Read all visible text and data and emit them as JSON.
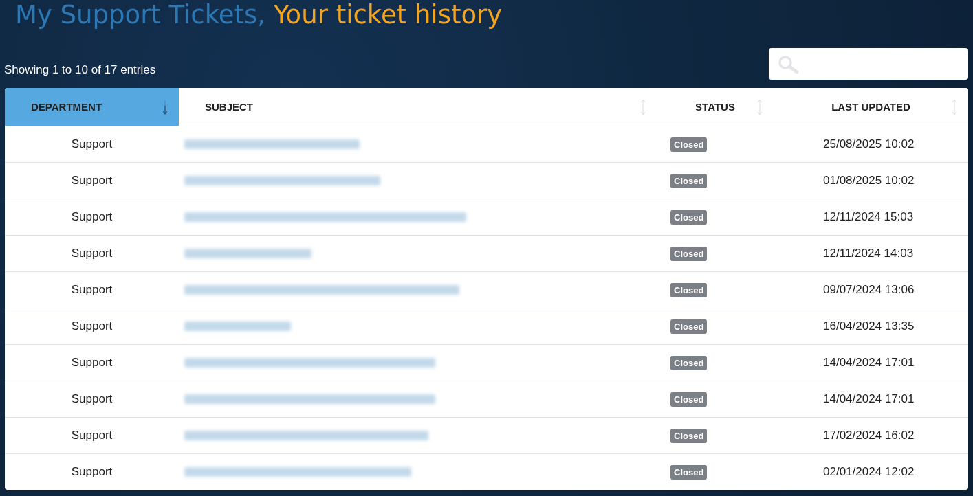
{
  "title": {
    "primary": "My Support Tickets,",
    "secondary": "Your ticket history"
  },
  "info": "Showing 1 to 10 of 17 entries",
  "table": {
    "columns": [
      {
        "label": "DEPARTMENT",
        "sorted": true
      },
      {
        "label": "SUBJECT",
        "sorted": false
      },
      {
        "label": "STATUS",
        "sorted": false
      },
      {
        "label": "LAST UPDATED",
        "sorted": false
      }
    ],
    "rows": [
      {
        "department": "Support",
        "subject": {
          "kind": "redacted"
        },
        "status": "Closed",
        "updated": "25/08/2025 10:02"
      },
      {
        "department": "Support",
        "subject": {
          "kind": "redacted"
        },
        "status": "Closed",
        "updated": "01/08/2025 10:02"
      },
      {
        "department": "Support",
        "subject": {
          "kind": "redacted"
        },
        "status": "Closed",
        "updated": "12/11/2024 15:03"
      },
      {
        "department": "Support",
        "subject": {
          "kind": "redacted"
        },
        "status": "Closed",
        "updated": "12/11/2024 14:03"
      },
      {
        "department": "Support",
        "subject": {
          "kind": "redacted"
        },
        "status": "Closed",
        "updated": "09/07/2024 13:06"
      },
      {
        "department": "Support",
        "subject": {
          "kind": "redacted"
        },
        "status": "Closed",
        "updated": "16/04/2024 13:35"
      },
      {
        "department": "Support",
        "subject": {
          "kind": "redacted"
        },
        "status": "Closed",
        "updated": "14/04/2024 17:01"
      },
      {
        "department": "Support",
        "subject": {
          "kind": "redacted"
        },
        "status": "Closed",
        "updated": "14/04/2024 17:01"
      },
      {
        "department": "Support",
        "subject": {
          "kind": "redacted"
        },
        "status": "Closed",
        "updated": "17/02/2024 16:02"
      },
      {
        "department": "Support",
        "subject": {
          "kind": "redacted"
        },
        "status": "Closed",
        "updated": "02/01/2024 12:02"
      }
    ]
  }
}
